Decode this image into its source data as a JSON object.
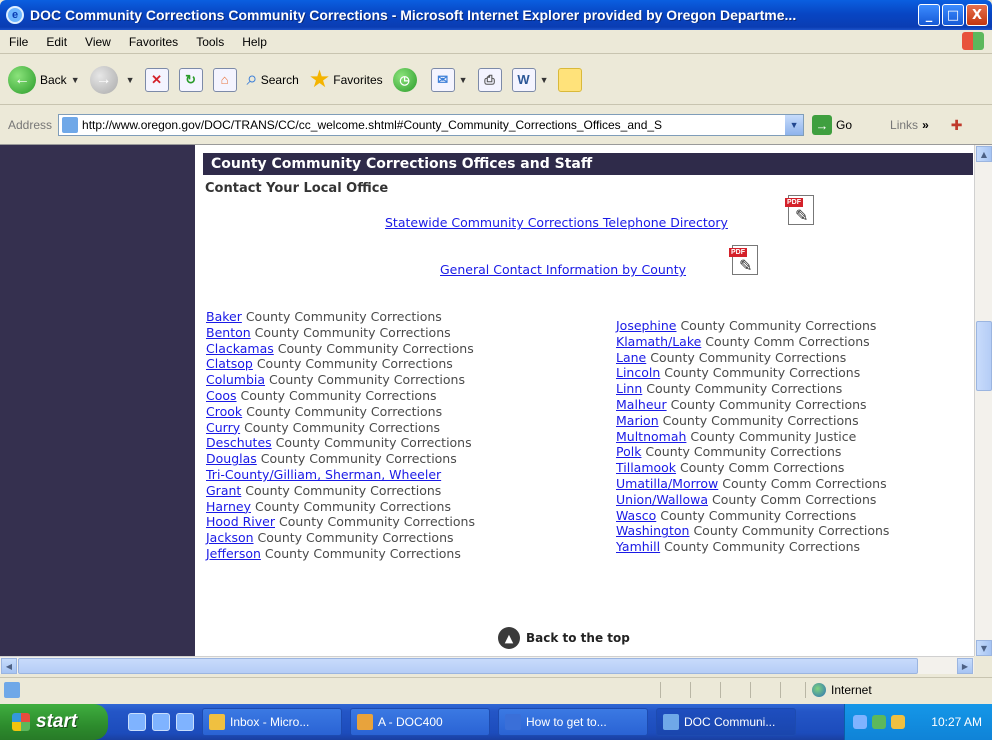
{
  "window": {
    "title": "DOC Community Corrections Community Corrections - Microsoft Internet Explorer provided by Oregon Departme...",
    "buttons": {
      "minimize": "_",
      "maximize": "□",
      "close": "X"
    }
  },
  "menu": [
    "File",
    "Edit",
    "View",
    "Favorites",
    "Tools",
    "Help"
  ],
  "toolbar": {
    "back": "Back",
    "search": "Search",
    "favorites": "Favorites"
  },
  "address": {
    "label": "Address",
    "url": "http://www.oregon.gov/DOC/TRANS/CC/cc_welcome.shtml#County_Community_Corrections_Offices_and_S",
    "go": "Go",
    "links": "Links",
    "links_more": "»"
  },
  "page": {
    "section_title": "County Community Corrections Offices and Staff",
    "subtitle": "Contact Your Local Office",
    "directory_link": "Statewide Community Corrections Telephone Directory",
    "general_link": "General Contact Information by County",
    "pdf_tag": "PDF",
    "counties_left": [
      {
        "link": "Baker",
        "text": " County Community Corrections"
      },
      {
        "link": "Benton",
        "text": " County Community Corrections"
      },
      {
        "link": "Clackamas",
        "text": " County Community Corrections"
      },
      {
        "link": "Clatsop",
        "text": " County Community Corrections"
      },
      {
        "link": "Columbia",
        "text": " County Community Corrections"
      },
      {
        "link": "Coos",
        "text": " County Community Corrections"
      },
      {
        "link": "Crook",
        "text": " County Community Corrections"
      },
      {
        "link": "Curry",
        "text": " County Community Corrections"
      },
      {
        "link": "Deschutes",
        "text": " County Community Corrections"
      },
      {
        "link": "Douglas",
        "text": " County Community Corrections"
      },
      {
        "link": "Tri-County/Gilliam, Sherman, Wheeler",
        "text": ""
      },
      {
        "link": "Grant",
        "text": " County Community Corrections"
      },
      {
        "link": "Harney",
        "text": " County Community Corrections"
      },
      {
        "link": "Hood River",
        "text": " County Community Corrections"
      },
      {
        "link": "Jackson",
        "text": " County Community Corrections"
      },
      {
        "link": "Jefferson",
        "text": " County Community Corrections"
      }
    ],
    "counties_right": [
      {
        "link": "Josephine",
        "text": " County Community Corrections"
      },
      {
        "link": "Klamath/Lake",
        "text": " County Comm Corrections"
      },
      {
        "link": "Lane",
        "text": " County Community Corrections"
      },
      {
        "link": "Lincoln",
        "text": " County Community Corrections"
      },
      {
        "link": "Linn",
        "text": " County Community Corrections"
      },
      {
        "link": "Malheur",
        "text": " County Community Corrections"
      },
      {
        "link": "Marion",
        "text": " County Community Corrections"
      },
      {
        "link": "Multnomah",
        "text": " County Community Justice"
      },
      {
        "link": "Polk",
        "text": " County Community Corrections"
      },
      {
        "link": "Tillamook",
        "text": " County Comm Corrections"
      },
      {
        "link": "Umatilla/Morrow",
        "text": " County Comm Corrections"
      },
      {
        "link": "Union/Wallowa",
        "text": " County Comm Corrections"
      },
      {
        "link": "Wasco",
        "text": " County Community Corrections"
      },
      {
        "link": "Washington",
        "text": " County Community Corrections"
      },
      {
        "link": "Yamhill",
        "text": " County Community Corrections"
      }
    ],
    "back_to_top": "Back to the top"
  },
  "status": {
    "zone": "Internet"
  },
  "taskbar": {
    "start": "start",
    "tasks": [
      {
        "label": "Inbox - Micro...",
        "color": "#f0c040"
      },
      {
        "label": "A - DOC400",
        "color": "#e8a33c"
      },
      {
        "label": "How to get to...",
        "color": "#3a6fd8"
      },
      {
        "label": "DOC Communi...",
        "color": "#6fa8e8"
      }
    ],
    "clock": "10:27 AM"
  },
  "colors": {
    "sidebar": "#35304f",
    "header_bar": "#2f2b4a",
    "link": "#1a1ae6"
  }
}
